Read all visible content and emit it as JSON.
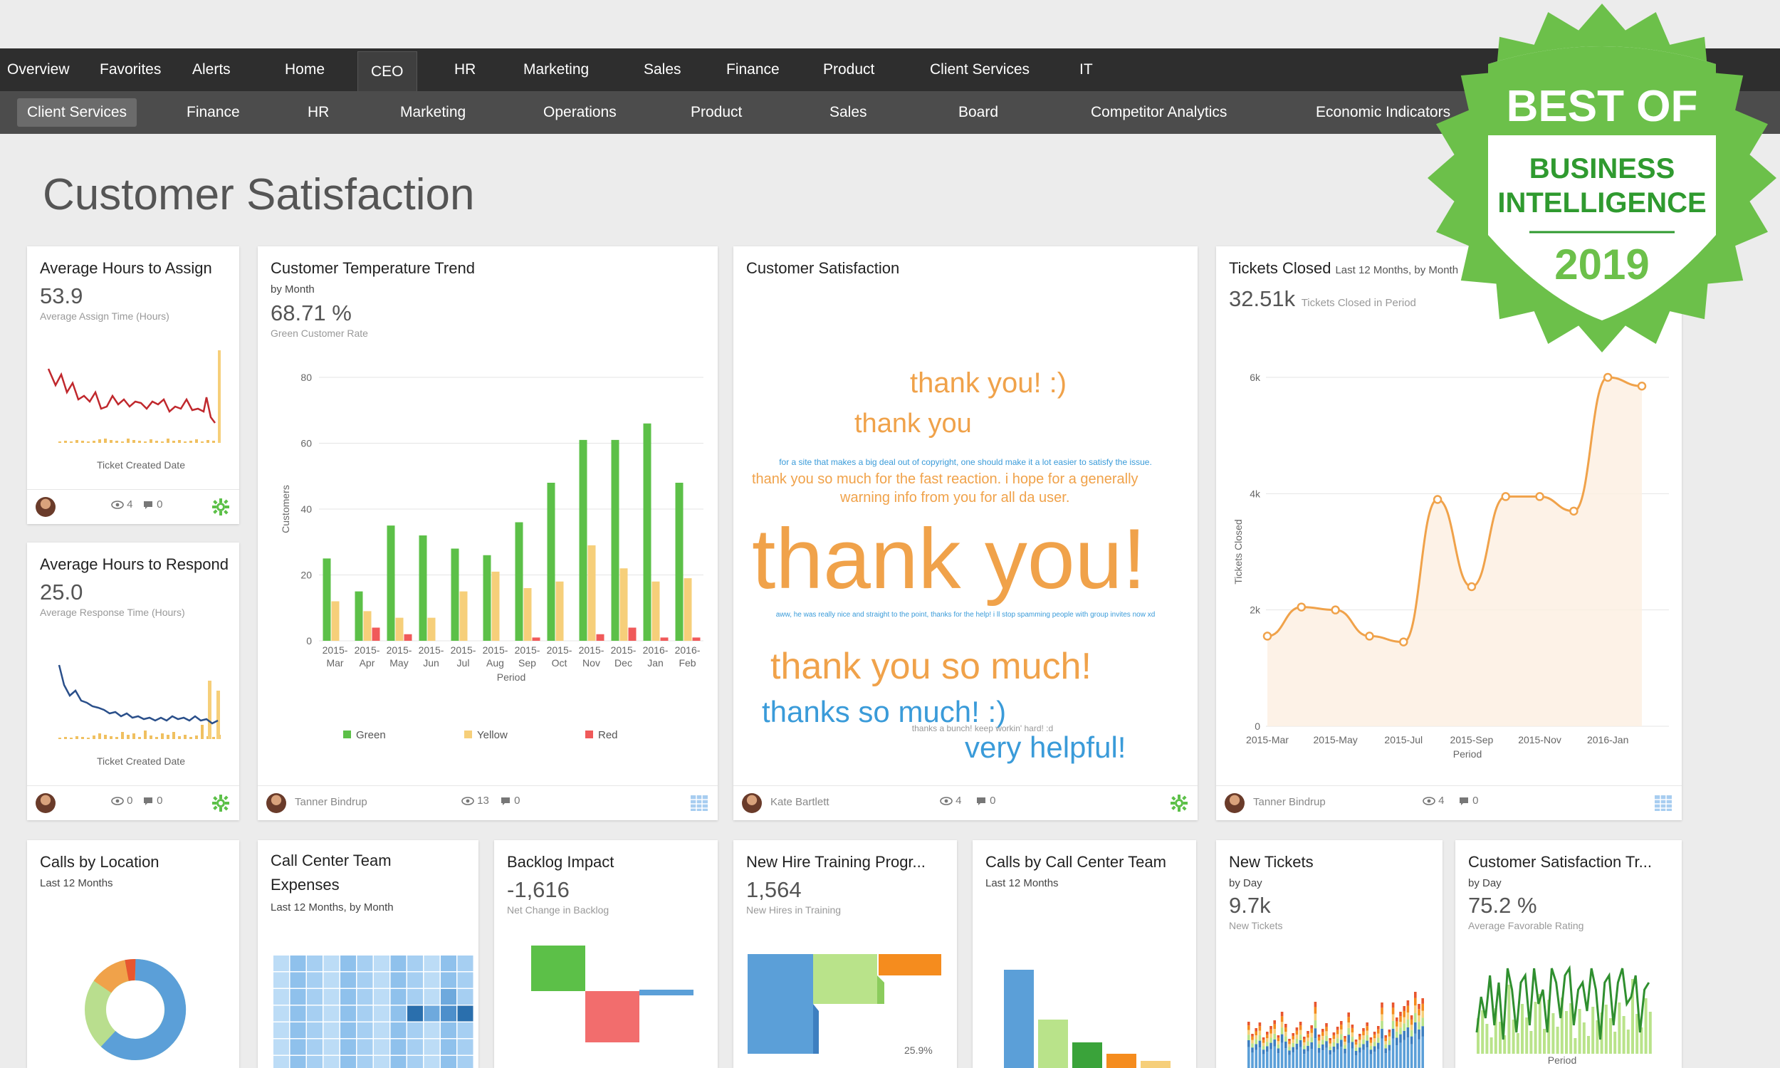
{
  "nav": {
    "top": [
      "Overview",
      "Favorites",
      "Alerts",
      "Home",
      "CEO",
      "HR",
      "Marketing",
      "Sales",
      "Finance",
      "Product",
      "Client Services",
      "IT"
    ],
    "top_active": "CEO",
    "sub": [
      "Client Services",
      "Finance",
      "HR",
      "Marketing",
      "Operations",
      "Product",
      "Sales",
      "Board",
      "Competitor Analytics",
      "Economic Indicators"
    ],
    "sub_active": "Client Services"
  },
  "page": {
    "title": "Customer Satisfaction"
  },
  "colors": {
    "green": "#5cc048",
    "yellow": "#f6cf7a",
    "red": "#f05a5a",
    "orange": "#f0a24a",
    "blue_text": "#3a9bd9",
    "navy": "#2a4f8a",
    "bar_blue": "#5b9fd8",
    "badge_green": "#6cc04a"
  },
  "cards": {
    "assign": {
      "title": "Average Hours to Assign",
      "value": "53.9",
      "caption": "Average Assign Time (Hours)",
      "axis": "Ticket Created Date",
      "views": "4",
      "comments": "0"
    },
    "respond": {
      "title": "Average Hours to Respond",
      "value": "25.0",
      "caption": "Average Response Time (Hours)",
      "axis": "Ticket Created Date",
      "views": "0",
      "comments": "0"
    },
    "temperature": {
      "title": "Customer Temperature Trend",
      "subtitle": "by Month",
      "value": "68.71 %",
      "caption": "Green Customer Rate",
      "owner": "Tanner Bindrup",
      "views": "13",
      "comments": "0"
    },
    "satisfaction": {
      "title": "Customer Satisfaction",
      "owner": "Kate Bartlett",
      "views": "4",
      "comments": "0"
    },
    "tickets_closed": {
      "title": "Tickets Closed",
      "title_suffix": "Last 12 Months, by Month",
      "value": "32.51k",
      "caption": "Tickets Closed in Period",
      "owner": "Tanner Bindrup",
      "views": "4",
      "comments": "0"
    },
    "calls_location": {
      "title": "Calls by Location",
      "subtitle": "Last 12 Months"
    },
    "expenses": {
      "title": "Call Center Team Expenses",
      "subtitle": "Last 12 Months, by Month"
    },
    "backlog": {
      "title": "Backlog Impact",
      "value": "-1,616",
      "caption": "Net Change in Backlog"
    },
    "newhire": {
      "title": "New Hire Training Progr...",
      "value": "1,564",
      "caption": "New Hires in Training",
      "pct": "25.9%"
    },
    "calls_team": {
      "title": "Calls by Call Center Team",
      "subtitle": "Last 12 Months"
    },
    "new_tickets": {
      "title": "New Tickets",
      "subtitle": "by Day",
      "value": "9.7k",
      "caption": "New Tickets"
    },
    "sat_trend": {
      "title": "Customer Satisfaction Tr...",
      "subtitle": "by Day",
      "value": "75.2 %",
      "caption": "Average Favorable Rating",
      "axis": "Period"
    }
  },
  "wordcloud": [
    {
      "text": "thank you! :)",
      "color": "#f0a24a",
      "size": 40
    },
    {
      "text": "thank you",
      "color": "#f0a24a",
      "size": 38
    },
    {
      "text": "for a site that makes a big deal out of copyright, one should make it a lot easier to satisfy the issue.",
      "color": "#3a9bd9",
      "size": 12
    },
    {
      "text": "thank you so much for the fast reaction. i hope for a generally",
      "color": "#f0a24a",
      "size": 20
    },
    {
      "text": "warning info from you for all da user.",
      "color": "#f0a24a",
      "size": 20
    },
    {
      "text": "thank you!",
      "color": "#f0a24a",
      "size": 120
    },
    {
      "text": "aww, he was really nice and straight to the point, thanks for the help! i ll stop spamming people with group invites now xd",
      "color": "#3a9bd9",
      "size": 10
    },
    {
      "text": "thank you so much!",
      "color": "#f0a24a",
      "size": 52
    },
    {
      "text": "thanks so much! :)",
      "color": "#3a9bd9",
      "size": 42
    },
    {
      "text": "thanks a bunch! keep workin' hard! :d",
      "color": "#999999",
      "size": 12
    },
    {
      "text": "very helpful!",
      "color": "#3a9bd9",
      "size": 42
    }
  ],
  "chart_data": [
    {
      "id": "temperature",
      "type": "bar",
      "xlabel": "Period",
      "ylabel": "Customers",
      "ylim": [
        0,
        80
      ],
      "yticks": [
        0,
        20,
        40,
        60,
        80
      ],
      "categories": [
        "2015-Mar",
        "2015-Apr",
        "2015-May",
        "2015-Jun",
        "2015-Jul",
        "2015-Aug",
        "2015-Sep",
        "2015-Oct",
        "2015-Nov",
        "2015-Dec",
        "2016-Jan",
        "2016-Feb"
      ],
      "series": [
        {
          "name": "Green",
          "color": "#5cc048",
          "values": [
            25,
            15,
            35,
            32,
            28,
            26,
            36,
            48,
            61,
            61,
            66,
            48
          ]
        },
        {
          "name": "Yellow",
          "color": "#f6cf7a",
          "values": [
            12,
            9,
            7,
            7,
            15,
            21,
            16,
            18,
            29,
            22,
            18,
            19
          ]
        },
        {
          "name": "Red",
          "color": "#f05a5a",
          "values": [
            0,
            4,
            2,
            0,
            0,
            0,
            1,
            0,
            2,
            4,
            1,
            1
          ]
        }
      ]
    },
    {
      "id": "tickets_closed",
      "type": "line",
      "xlabel": "Period",
      "ylabel": "Tickets Closed",
      "ylim": [
        0,
        6000
      ],
      "yticks": [
        "0",
        "2k",
        "4k",
        "6k"
      ],
      "xticks": [
        "2015-Mar",
        "2015-May",
        "2015-Jul",
        "2015-Sep",
        "2015-Nov",
        "2016-Jan"
      ],
      "x": [
        "2015-Mar",
        "2015-Apr",
        "2015-May",
        "2015-Jun",
        "2015-Jul",
        "2015-Aug",
        "2015-Sep",
        "2015-Oct",
        "2015-Nov",
        "2015-Dec",
        "2016-Jan",
        "2016-Feb"
      ],
      "values": [
        1550,
        2050,
        2000,
        1550,
        1450,
        3900,
        2400,
        3950,
        3950,
        3700,
        6000,
        5850
      ]
    }
  ],
  "badge": {
    "line1": "BEST OF",
    "line2": "BUSINESS",
    "line3": "INTELLIGENCE",
    "year": "2019"
  }
}
